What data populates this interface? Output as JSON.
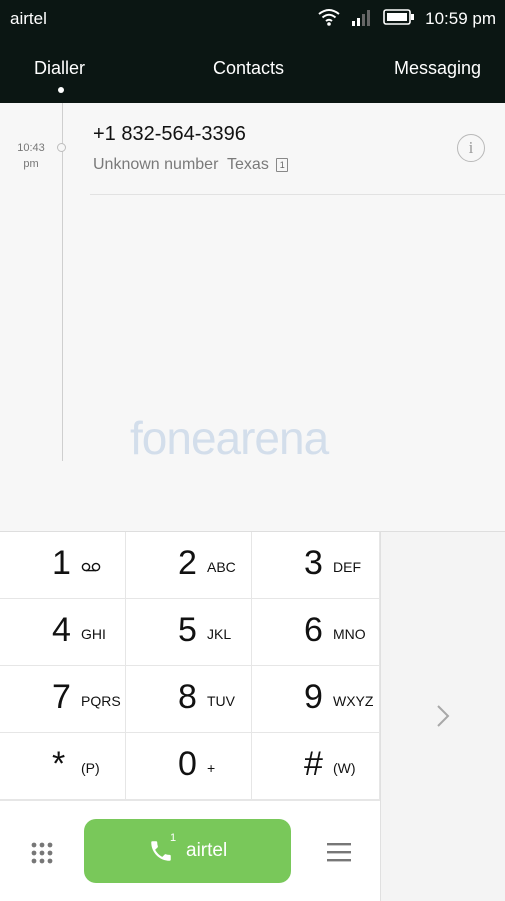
{
  "status": {
    "carrier": "airtel",
    "time": "10:59 pm"
  },
  "tabs": [
    {
      "label": "Dialler",
      "active": true
    },
    {
      "label": "Contacts",
      "active": false
    },
    {
      "label": "Messaging",
      "active": false
    }
  ],
  "log": {
    "entries": [
      {
        "time": "10:43",
        "period": "pm",
        "number": "+1 832-564-3396",
        "type": "Unknown number",
        "location": "Texas",
        "sim": "1"
      }
    ]
  },
  "watermark": {
    "text": "fonearena"
  },
  "keypad": {
    "keys": [
      {
        "digit": "1",
        "letters": "oo"
      },
      {
        "digit": "2",
        "letters": "ABC"
      },
      {
        "digit": "3",
        "letters": "DEF"
      },
      {
        "digit": "4",
        "letters": "GHI"
      },
      {
        "digit": "5",
        "letters": "JKL"
      },
      {
        "digit": "6",
        "letters": "MNO"
      },
      {
        "digit": "7",
        "letters": "PQRS"
      },
      {
        "digit": "8",
        "letters": "TUV"
      },
      {
        "digit": "9",
        "letters": "WXYZ"
      },
      {
        "digit": "*",
        "letters": "(P)"
      },
      {
        "digit": "0",
        "letters": "+"
      },
      {
        "digit": "#",
        "letters": "(W)"
      }
    ]
  },
  "call_button": {
    "label": "airtel",
    "sim": "1"
  },
  "colors": {
    "bar_bg": "#0b1613",
    "call_green": "#79c85a"
  },
  "icons": {
    "wifi": "wifi-icon",
    "signal": "signal-icon",
    "battery": "battery-icon",
    "info": "info-icon",
    "chevron": "chevron-right-icon",
    "grid": "dialpad-grid-icon",
    "menu": "menu-icon",
    "phone": "phone-icon"
  }
}
